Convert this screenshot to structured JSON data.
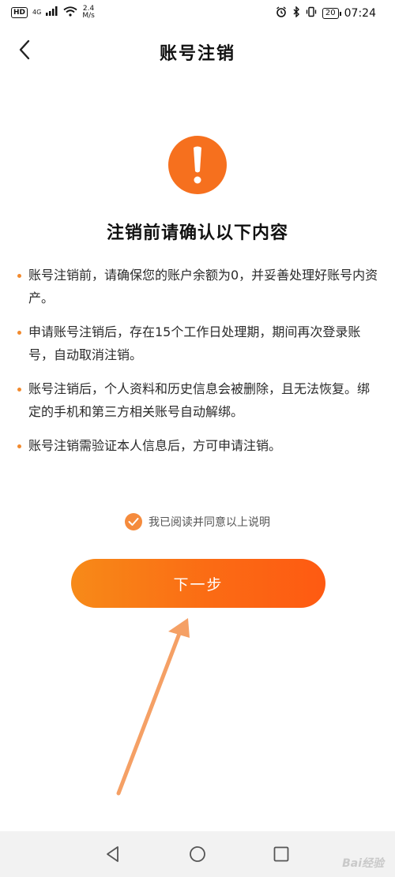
{
  "status_bar": {
    "hd": "HD",
    "network": "4G",
    "speed_value": "2.4",
    "speed_unit": "M/s",
    "battery": "20",
    "time": "07:24",
    "icons": [
      "signal-icon",
      "wifi-icon",
      "alarm-icon",
      "bluetooth-icon",
      "vibrate-icon",
      "battery-icon"
    ]
  },
  "header": {
    "title": "账号注销",
    "back_icon": "chevron-left-icon"
  },
  "content": {
    "warning_icon": "exclamation-icon",
    "heading": "注销前请确认以下内容",
    "notes": [
      "账号注销前，请确保您的账户余额为0，并妥善处理好账号内资产。",
      "申请账号注销后，存在15个工作日处理期，期间再次登录账号，自动取消注销。",
      "账号注销后，个人资料和历史信息会被删除，且无法恢复。绑定的手机和第三方相关账号自动解绑。",
      "账号注销需验证本人信息后，方可申请注销。"
    ],
    "agree_label": "我已阅读并同意以上说明",
    "agree_checked": true,
    "next_button": "下一步"
  },
  "colors": {
    "accent": "#f6701e",
    "button_start": "#f78a18",
    "button_end": "#fe5a12",
    "annotation_arrow": "#f5a065"
  },
  "system_nav": {
    "back_icon": "triangle-back-icon",
    "home_icon": "circle-home-icon",
    "recent_icon": "square-recent-icon"
  },
  "watermark": "Bai经验"
}
